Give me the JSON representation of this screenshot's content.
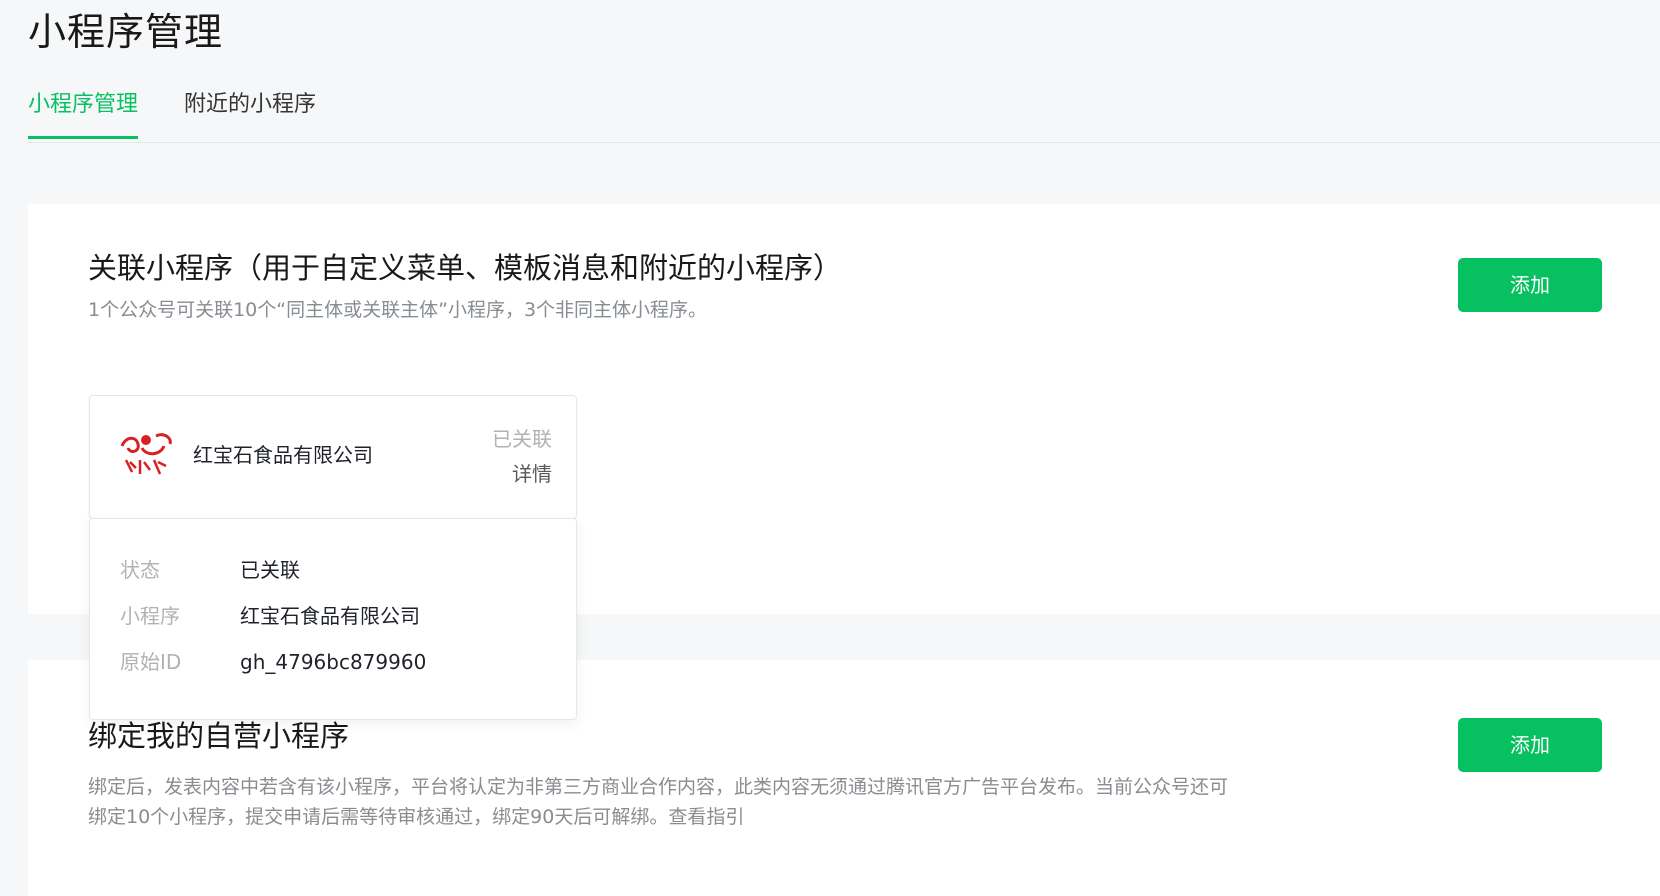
{
  "page": {
    "title": "小程序管理"
  },
  "tabs": [
    {
      "label": "小程序管理",
      "active": true
    },
    {
      "label": "附近的小程序",
      "active": false
    }
  ],
  "linked_section": {
    "title": "关联小程序（用于自定义菜单、模板消息和附近的小程序）",
    "description": "1个公众号可关联10个“同主体或关联主体”小程序，3个非同主体小程序。",
    "add_label": "添加",
    "mini_program": {
      "name": "红宝石食品有限公司",
      "status": "已关联",
      "detail_label": "详情",
      "logo_icon": "ruby-logo-icon"
    }
  },
  "details_popover": {
    "rows": [
      {
        "label": "状态",
        "value": "已关联"
      },
      {
        "label": "小程序",
        "value": "红宝石食品有限公司"
      },
      {
        "label": "原始ID",
        "value": "gh_4796bc879960"
      }
    ]
  },
  "bind_section": {
    "title": "绑定我的自营小程序",
    "description_line1": "绑定后，发表内容中若含有该小程序，平台将认定为非第三方商业合作内容，此类内容无须通过腾讯官方广告平台发布。当前公众号还可",
    "description_line2": "绑定10个小程序，提交申请后需等待审核通过，绑定90天后可解绑。查看指引",
    "add_label": "添加"
  },
  "colors": {
    "accent": "#07c160",
    "background": "#f6f7f8",
    "muted_text": "#b2b2b2",
    "desc_text": "#888d92"
  }
}
